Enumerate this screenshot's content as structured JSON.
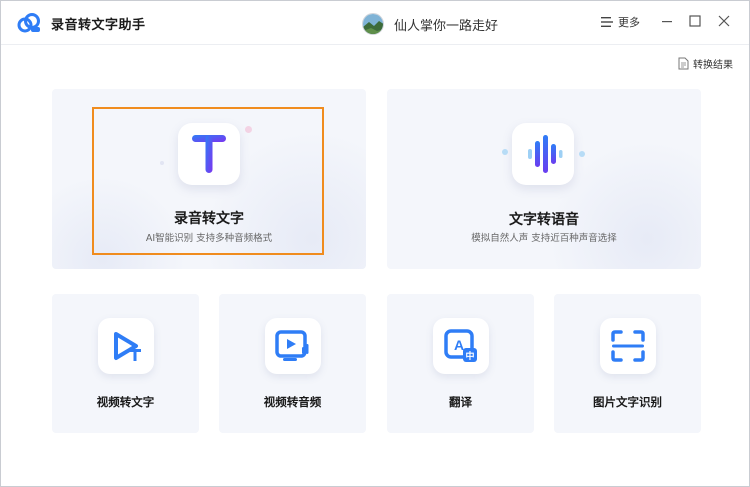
{
  "app": {
    "title": "录音转文字助手"
  },
  "user": {
    "name": "仙人掌你一路走好"
  },
  "header": {
    "more_label": "更多"
  },
  "toolbar": {
    "result_label": "转换结果"
  },
  "main_features": [
    {
      "title": "录音转文字",
      "subtitle": "AI智能识别 支持多种音频格式",
      "icon": "letter-t-icon",
      "selected": true
    },
    {
      "title": "文字转语音",
      "subtitle": "模拟自然人声 支持近百种声音选择",
      "icon": "sound-wave-icon",
      "selected": false
    }
  ],
  "tools": [
    {
      "title": "视频转文字",
      "icon": "video-to-text-icon"
    },
    {
      "title": "视频转音频",
      "icon": "video-to-audio-icon"
    },
    {
      "title": "翻译",
      "icon": "translate-icon"
    },
    {
      "title": "图片文字识别",
      "icon": "image-ocr-icon"
    }
  ],
  "colors": {
    "accent_blue": "#2f7df6",
    "accent_purple": "#6a3df0",
    "focus_orange": "#f08c1e",
    "card_bg": "#f4f6fb"
  }
}
